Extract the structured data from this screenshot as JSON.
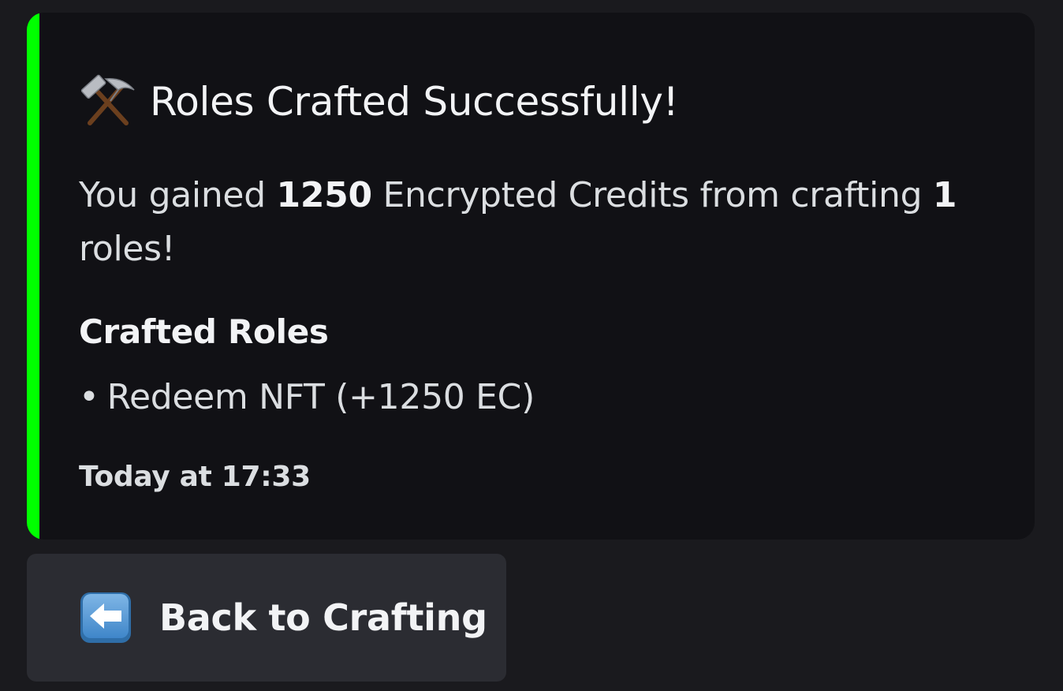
{
  "embed": {
    "accent_color": "#00ff00",
    "title_icon": "hammer-and-pick-icon",
    "title": "Roles Crafted Successfully!",
    "description": {
      "part1": "You gained ",
      "amount": "1250",
      "part2": " Encrypted Credits from crafting ",
      "count": "1",
      "part3": " roles!"
    },
    "field": {
      "name": "Crafted Roles",
      "bullet": "•",
      "value": "Redeem NFT (+1250 EC)"
    },
    "timestamp": "Today at 17:33"
  },
  "button": {
    "icon": "left-arrow-icon",
    "label": "Back to Crafting"
  }
}
